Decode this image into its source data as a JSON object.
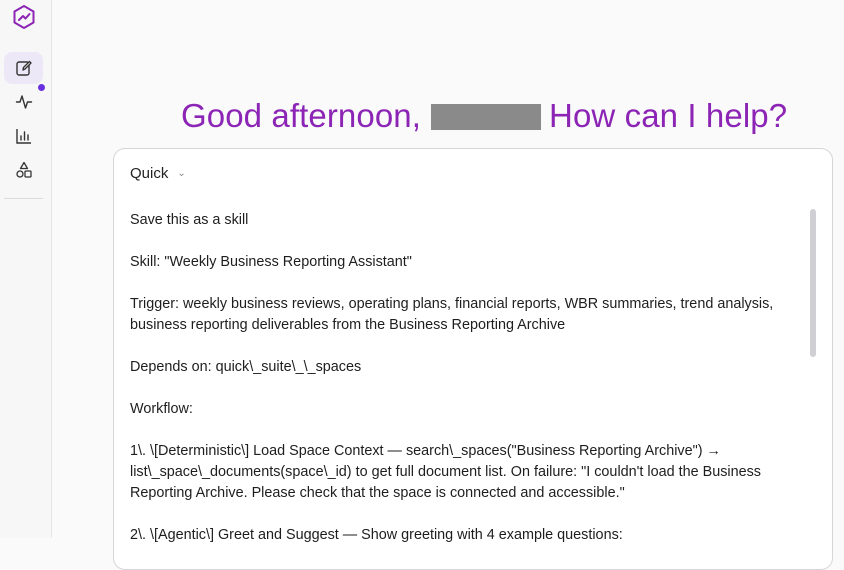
{
  "app": {
    "sidebar": {
      "items": [
        {
          "icon": "compose-icon",
          "active": true
        },
        {
          "icon": "activity-icon",
          "active": false
        },
        {
          "icon": "chart-icon",
          "active": false
        },
        {
          "icon": "shapes-icon",
          "active": false
        }
      ],
      "accent": "#6a2fe0"
    },
    "greeting": {
      "before": "Good afternoon,",
      "after": "How can I help?",
      "color": "#8c25b5"
    },
    "composer": {
      "mode_label": "Quick",
      "lines": [
        "Save this as a skill",
        "Skill: \"Weekly Business Reporting Assistant\"",
        "Trigger: weekly business reviews, operating plans, financial reports, WBR summaries, trend analysis, business reporting deliverables from the Business Reporting Archive",
        "Depends on: quick\\_suite\\_\\_spaces",
        "Workflow:",
        "1\\. \\[Deterministic\\] Load Space Context — search\\_spaces(\"Business Reporting Archive\") → list\\_space\\_documents(space\\_id) to get full document list. On failure: \"I couldn't load the Business Reporting Archive. Please check that the space is connected and accessible.\"",
        "2\\. \\[Agentic\\] Greet and Suggest — Show greeting with 4 example questions:"
      ]
    }
  }
}
